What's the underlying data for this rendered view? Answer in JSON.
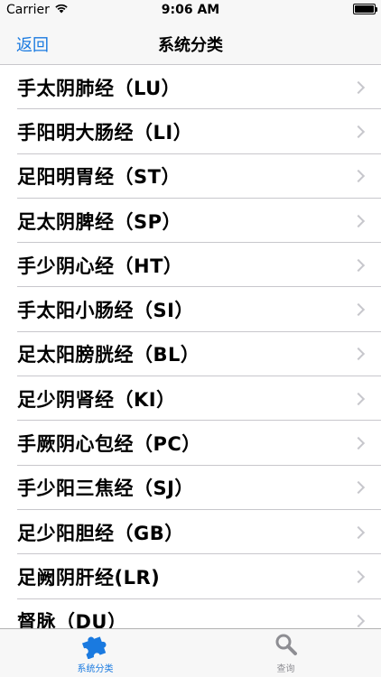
{
  "status_bar": {
    "carrier": "Carrier",
    "time": "9:06 AM",
    "wifi_icon": "wifi-icon",
    "battery_icon": "battery-icon"
  },
  "nav": {
    "back_label": "返回",
    "title": "系统分类"
  },
  "items": [
    {
      "label": "手太阴肺经（LU）"
    },
    {
      "label": "手阳明大肠经（LI）"
    },
    {
      "label": "足阳明胃经（ST）"
    },
    {
      "label": "足太阴脾经（SP）"
    },
    {
      "label": "手少阴心经（HT）"
    },
    {
      "label": "手太阳小肠经（SI）"
    },
    {
      "label": "足太阳膀胱经（BL）"
    },
    {
      "label": "足少阴肾经（KI）"
    },
    {
      "label": "手厥阴心包经（PC）"
    },
    {
      "label": "手少阳三焦经（SJ）"
    },
    {
      "label": "足少阳胆经（GB）"
    },
    {
      "label": "足阙阴肝经(LR)"
    },
    {
      "label": "督脉（DU）"
    }
  ],
  "tabs": [
    {
      "label": "系统分类",
      "icon": "puzzle-icon",
      "active": true
    },
    {
      "label": "查询",
      "icon": "search-icon",
      "active": false
    }
  ],
  "colors": {
    "accent": "#1a7ae0",
    "inactive": "#8e8e93",
    "separator": "#c8c7cc",
    "bar_background": "#f7f7f7"
  }
}
